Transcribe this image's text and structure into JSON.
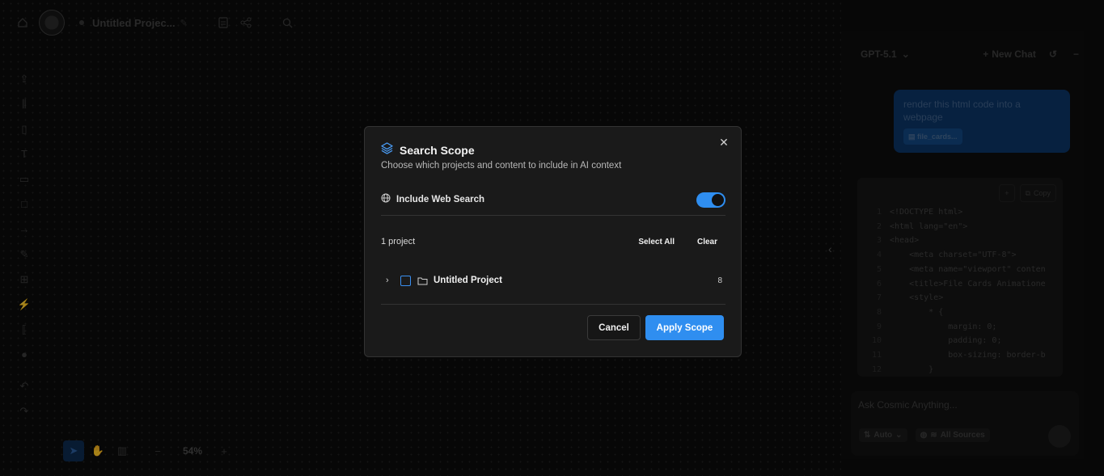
{
  "app": {
    "project_name": "Untitled Projec...",
    "zoom": "54%"
  },
  "chat": {
    "model": "GPT-5.1",
    "new_chat": "New Chat",
    "user_message": "render this html code into a webpage",
    "attachment": "file_cards...",
    "copy_label": "Copy",
    "code_lines": [
      {
        "n": "1",
        "code": "<!DOCTYPE html>"
      },
      {
        "n": "2",
        "code": "<html lang=\"en\">"
      },
      {
        "n": "3",
        "code": "<head>"
      },
      {
        "n": "4",
        "code": "    <meta charset=\"UTF-8\">"
      },
      {
        "n": "5",
        "code": "    <meta name=\"viewport\" conten"
      },
      {
        "n": "6",
        "code": "    <title>File Cards Animatione"
      },
      {
        "n": "7",
        "code": "    <style>"
      },
      {
        "n": "8",
        "code": "        * {"
      },
      {
        "n": "9",
        "code": "            margin: 0;"
      },
      {
        "n": "10",
        "code": "            padding: 0;"
      },
      {
        "n": "11",
        "code": "            box-sizing: border-b"
      },
      {
        "n": "12",
        "code": "        }"
      }
    ],
    "composer_placeholder": "Ask Cosmic Anything...",
    "mode": "Auto",
    "sources": "All Sources"
  },
  "modal": {
    "title": "Search Scope",
    "subtitle": "Choose which projects and content to include in AI context",
    "web_search_label": "Include Web Search",
    "web_search_enabled": true,
    "project_count": "1 project",
    "select_all": "Select All",
    "clear": "Clear",
    "projects": [
      {
        "name": "Untitled Project",
        "count": "8",
        "checked": false
      }
    ],
    "cancel": "Cancel",
    "apply": "Apply Scope",
    "accent": "#2f8ef0"
  }
}
